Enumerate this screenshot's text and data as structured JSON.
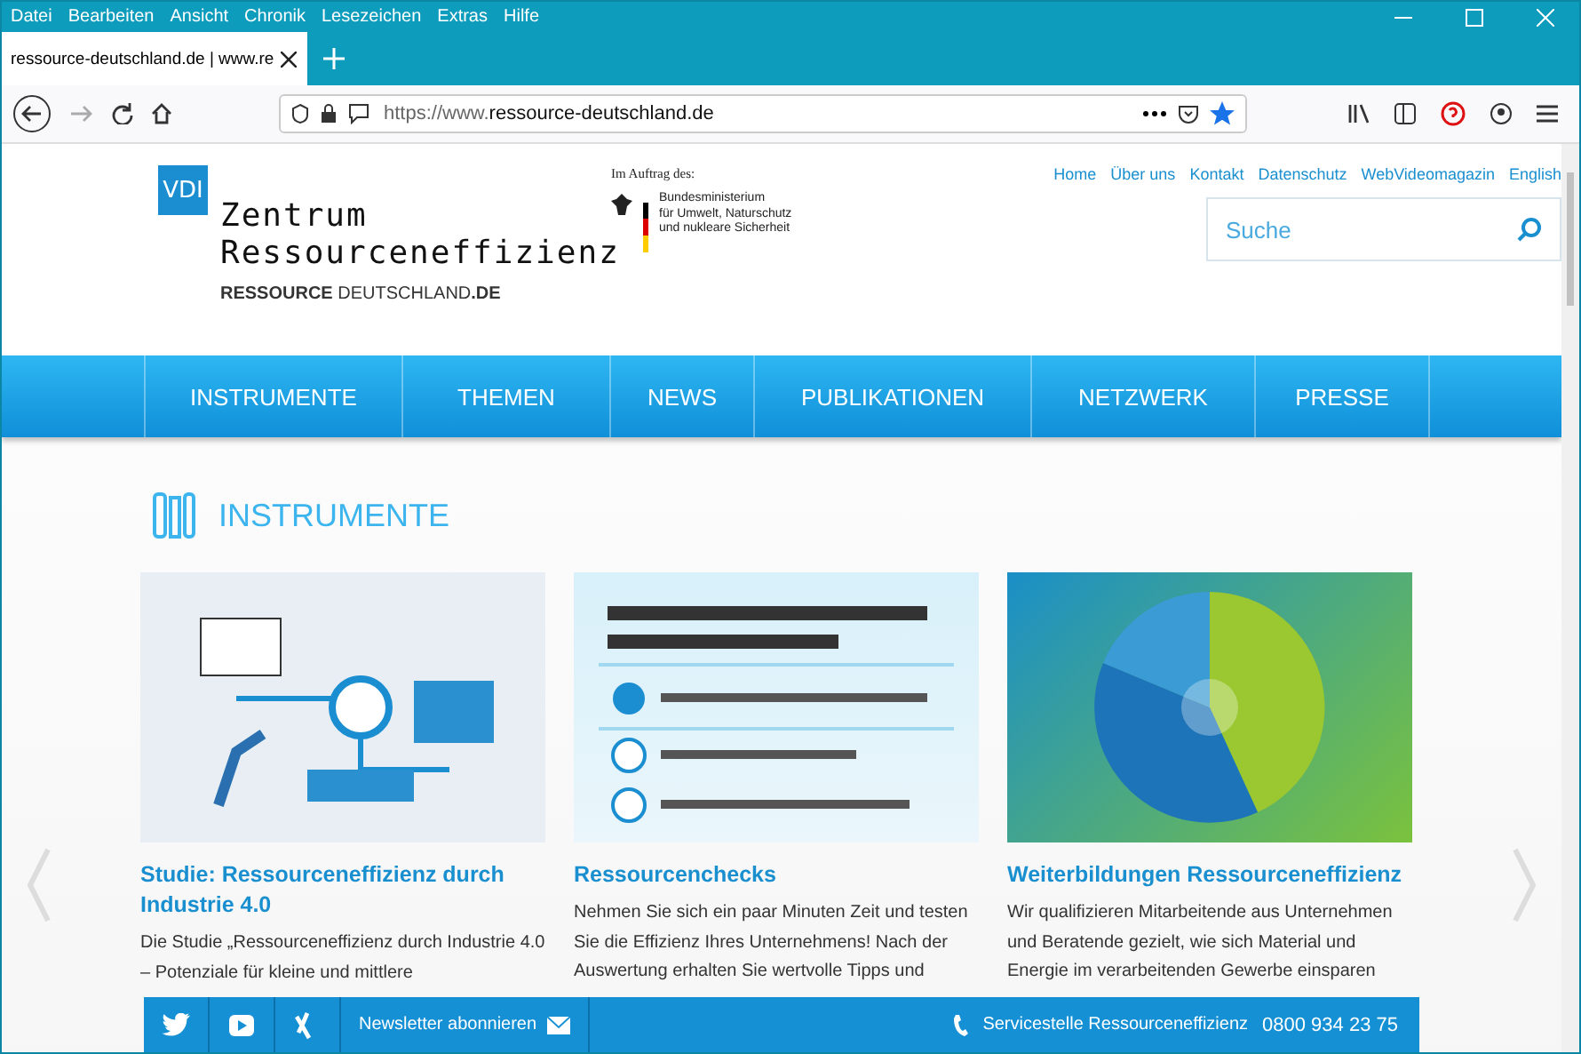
{
  "menu_bar": [
    "Datei",
    "Bearbeiten",
    "Ansicht",
    "Chronik",
    "Lesezeichen",
    "Extras",
    "Hilfe"
  ],
  "tab": {
    "title": "ressource-deutschland.de | www.re"
  },
  "address_bar": {
    "url_prefix": "https://www.",
    "url_domain": "ressource-deutschland.de",
    "bookmarked": true
  },
  "header": {
    "logo_badge": "VDI",
    "logo_line_1": "Zentrum",
    "logo_line_2": "Ressourceneffizienz",
    "brand": "**RESSOURCE** DEUTSCHLAND**.DE**",
    "sponsor_label": "Im Auftrag des:",
    "ministry_lines": [
      "Bundesministerium",
      "für Umwelt, Naturschutz",
      "und nukleare Sicherheit"
    ],
    "top_links": [
      "Home",
      "Über uns",
      "Kontakt",
      "Datenschutz",
      "WebVideomagazin",
      "English"
    ],
    "search": {
      "placeholder": "Suche"
    }
  },
  "nav": [
    "INSTRUMENTE",
    "THEMEN",
    "NEWS",
    "PUBLIKATIONEN",
    "NETZWERK",
    "PRESSE"
  ],
  "section_title": "INSTRUMENTE",
  "cards": [
    {
      "kind": "industry",
      "title": "Studie: Ressourceneffizienz durch Industrie 4.0",
      "text": "Die Studie „Ressourceneffizienz durch Industrie 4.0 – Potenziale für kleine und mittlere"
    },
    {
      "kind": "quiz",
      "title": "Ressourcenchecks",
      "text": "Nehmen Sie sich ein paar Minuten Zeit und testen Sie die Effizienz Ihres Unternehmens! Nach der Auswertung erhalten Sie wertvolle Tipps und"
    },
    {
      "kind": "pie",
      "title": "Weiterbildungen Ressourceneffizienz",
      "text": "Wir qualifizieren Mitarbeitende aus Unternehmen und Beratende gezielt, wie sich Material und Energie im verarbeitenden Gewerbe einsparen"
    }
  ],
  "footer_bar": {
    "newsletter": "Newsletter abonnieren",
    "service": "Servicestelle Ressourceneffizienz",
    "phone": "0800 934 23 75"
  }
}
